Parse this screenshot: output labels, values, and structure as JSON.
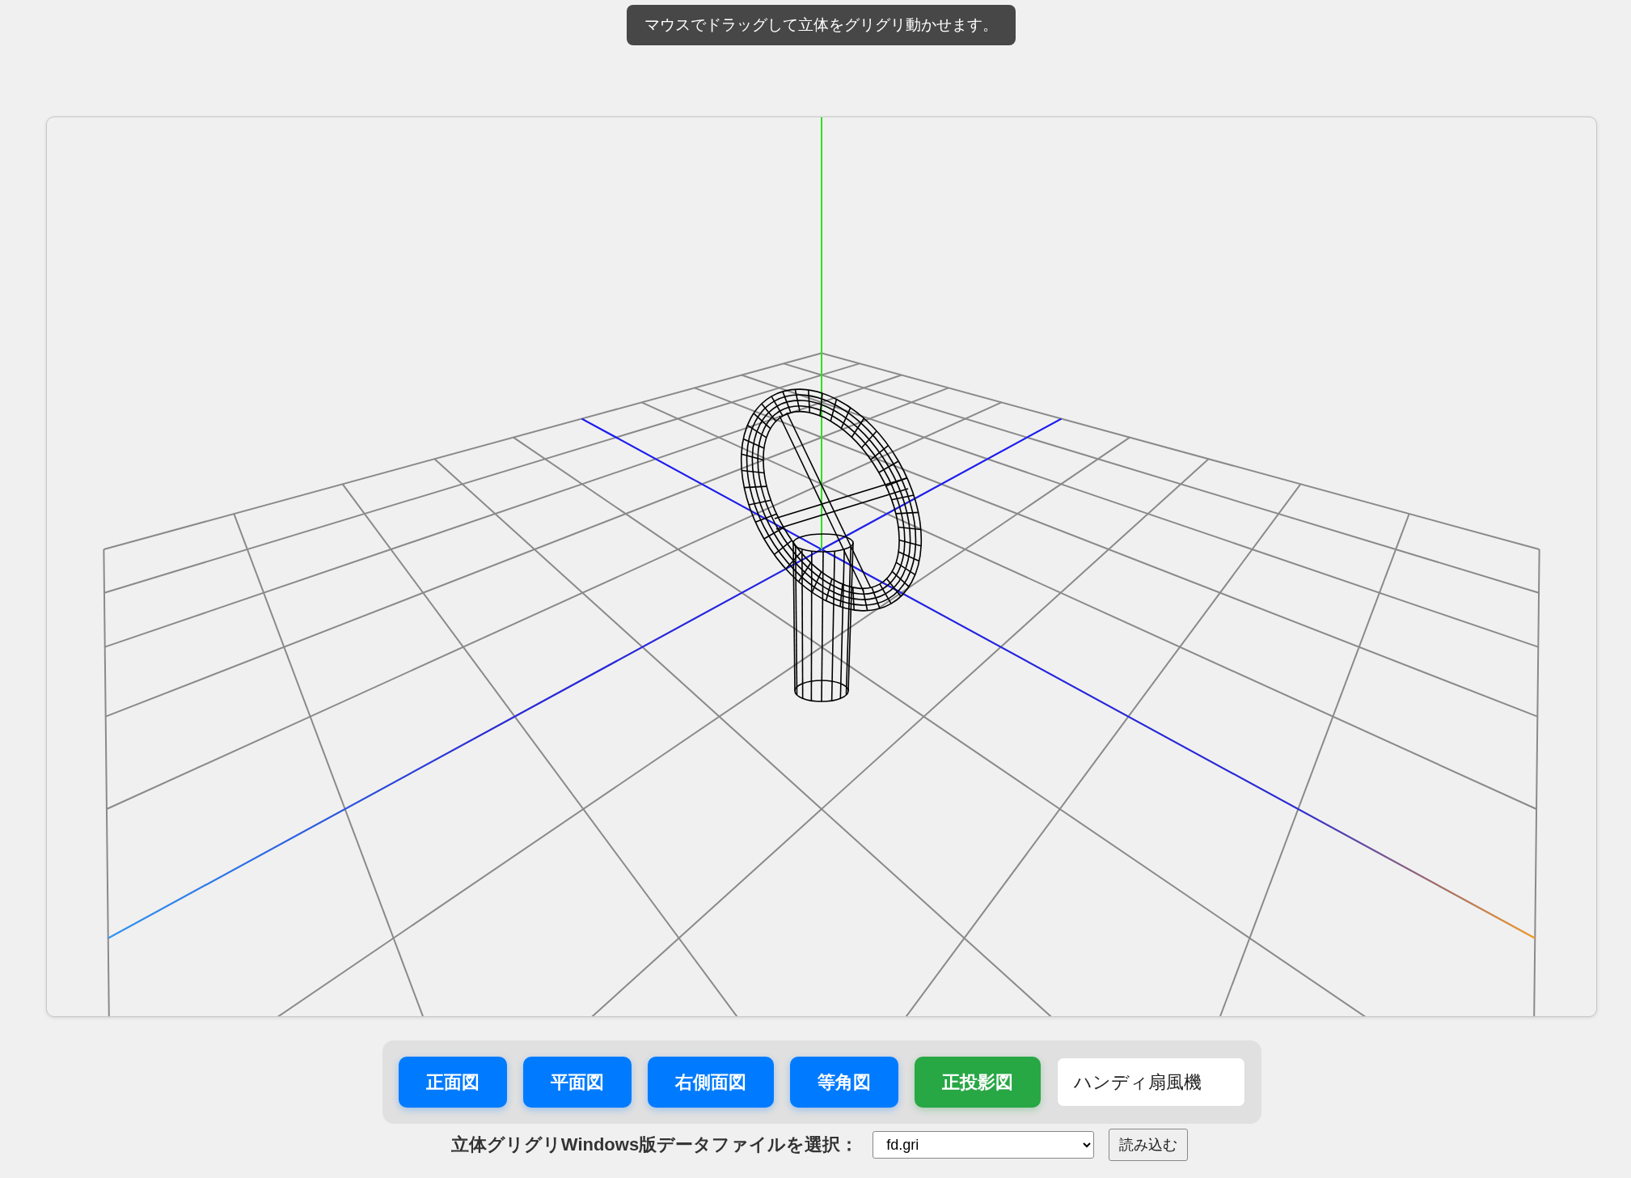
{
  "hint": "マウスでドラッグして立体をグリグリ動かせます。",
  "toolbar": {
    "buttons": [
      {
        "label": "正面図",
        "kind": "view"
      },
      {
        "label": "平面図",
        "kind": "view"
      },
      {
        "label": "右側面図",
        "kind": "view"
      },
      {
        "label": "等角図",
        "kind": "view"
      },
      {
        "label": "正投影図",
        "kind": "projection",
        "on": true
      }
    ],
    "model_name": {
      "value": "ハンディ扇風機"
    }
  },
  "file_picker": {
    "label": "立体グリグリWindows版データファイルを選択：",
    "value": "fd.gri",
    "button": "読み込む"
  }
}
